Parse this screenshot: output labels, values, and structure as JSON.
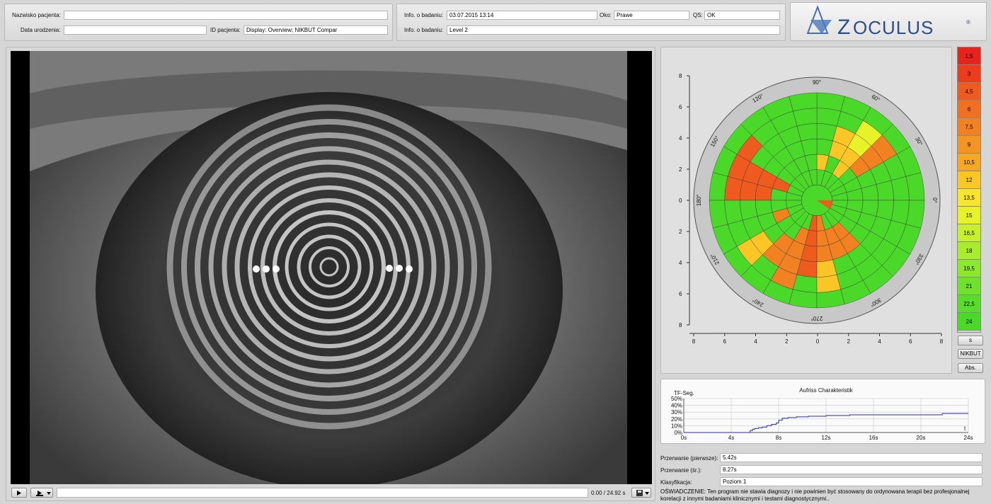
{
  "header": {
    "patient_name_label": "Nazwisko pacjenta:",
    "patient_name_value": "",
    "birth_date_label": "Data urodzenia:",
    "birth_date_value": "",
    "patient_id_label": "ID pacjenta:",
    "patient_id_value": "Display: Overview; NIKBUT Compar",
    "exam_info_label_1": "Info. o badaniu:",
    "exam_info_value_1": "03.07.2015 13:14",
    "eye_label": "Oko:",
    "eye_value": "Prawe",
    "qs_label": "QS:",
    "qs_value": "OK",
    "exam_info_label_2": "Info. o badaniu:",
    "exam_info_value_2": "Level 2"
  },
  "logo": {
    "text": "OCULUS",
    "reg": "®"
  },
  "video": {
    "play_icon": "play-icon",
    "time_readout": "0.00 / 24.92 s"
  },
  "polar_plot": {
    "axis_ticks": [
      "8",
      "6",
      "4",
      "2",
      "0",
      "2",
      "4",
      "6",
      "8"
    ],
    "angle_labels": [
      "90°",
      "60°",
      "30°",
      "0°",
      "330°",
      "300°",
      "270°",
      "240°",
      "210°",
      "180°",
      "150°",
      "120°"
    ]
  },
  "scale": {
    "values": [
      "1,5",
      "3",
      "4,5",
      "6",
      "7,5",
      "9",
      "10,5",
      "12",
      "13,5",
      "15",
      "16,5",
      "18",
      "19,5",
      "21",
      "22,5",
      "24"
    ],
    "colors": [
      "#e8231c",
      "#ec3b1d",
      "#ef5a1f",
      "#f06f20",
      "#f28121",
      "#f49522",
      "#f7a823",
      "#fbc626",
      "#fbe52a",
      "#e8f229",
      "#c8f02b",
      "#a8ec2b",
      "#8ce82b",
      "#6fe32b",
      "#58dd2a",
      "#4bd929"
    ],
    "buttons": [
      "s",
      "NIKBUT",
      "Abs."
    ]
  },
  "chart_data": {
    "type": "line",
    "title": "Aufriss Charakteristik",
    "ylabel": "TF-Seg.",
    "xlabel": "t",
    "x_ticks": [
      "0s",
      "4s",
      "8s",
      "12s",
      "16s",
      "20s",
      "24s"
    ],
    "y_ticks": [
      "0%",
      "10%",
      "20%",
      "30%",
      "40%",
      "50%"
    ],
    "xlim": [
      0,
      24
    ],
    "ylim": [
      0,
      50
    ],
    "grid": true,
    "series": [
      {
        "x": [
          0,
          5.4,
          5.6,
          5.8,
          6.0,
          6.3,
          6.6,
          7.0,
          7.4,
          7.8,
          8.0,
          8.3,
          8.8,
          9.5,
          10.5,
          12.0,
          14.0,
          18.0,
          21.0,
          21.8,
          24.0
        ],
        "y": [
          0,
          0,
          3,
          5,
          6,
          7,
          8,
          10,
          12,
          14,
          18,
          21,
          22,
          23,
          24,
          25,
          26,
          26,
          26,
          28,
          28
        ]
      }
    ]
  },
  "results": {
    "first_break_label": "Przerwanie (pierwsze):",
    "first_break_value": "5.42s",
    "avg_break_label": "Przerwanie (śr.):",
    "avg_break_value": "8.27s",
    "classification_label": "Klasyfikacja:",
    "classification_value": "Poziom 1",
    "disclaimer": "OŚWIADCZENIE: Ten program nie stawia diagnozy i nie powinien być stosowany do ordynowana terapii bez profesjonalnej korelacji z innymi badaniami klinicznymi i testami diagnostycznymi.."
  }
}
